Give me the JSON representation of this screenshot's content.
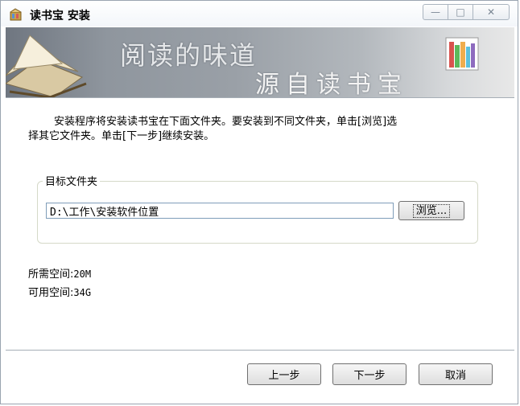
{
  "window": {
    "title": "读书宝 安装",
    "icon": "installer-app-icon",
    "controls": {
      "minimize": "minimize-icon",
      "maximize": "maximize-icon",
      "close": "close-icon"
    }
  },
  "banner": {
    "title": "阅读的味道",
    "subtitle": "源自读书宝"
  },
  "intro": {
    "line1": "安装程序将安装读书宝在下面文件夹。要安装到不同文件夹，单击[浏览]选",
    "line2": "择其它文件夹。单击[下一步]继续安装。"
  },
  "destination": {
    "legend": "目标文件夹",
    "path_value": "D:\\工作\\安装软件位置",
    "browse_label": "浏览..."
  },
  "space": {
    "required_label": "所需空间:",
    "required_value": "20M",
    "available_label": "可用空间:",
    "available_value": "34G"
  },
  "buttons": {
    "prev": "上一步",
    "next": "下一步",
    "cancel": "取消"
  }
}
